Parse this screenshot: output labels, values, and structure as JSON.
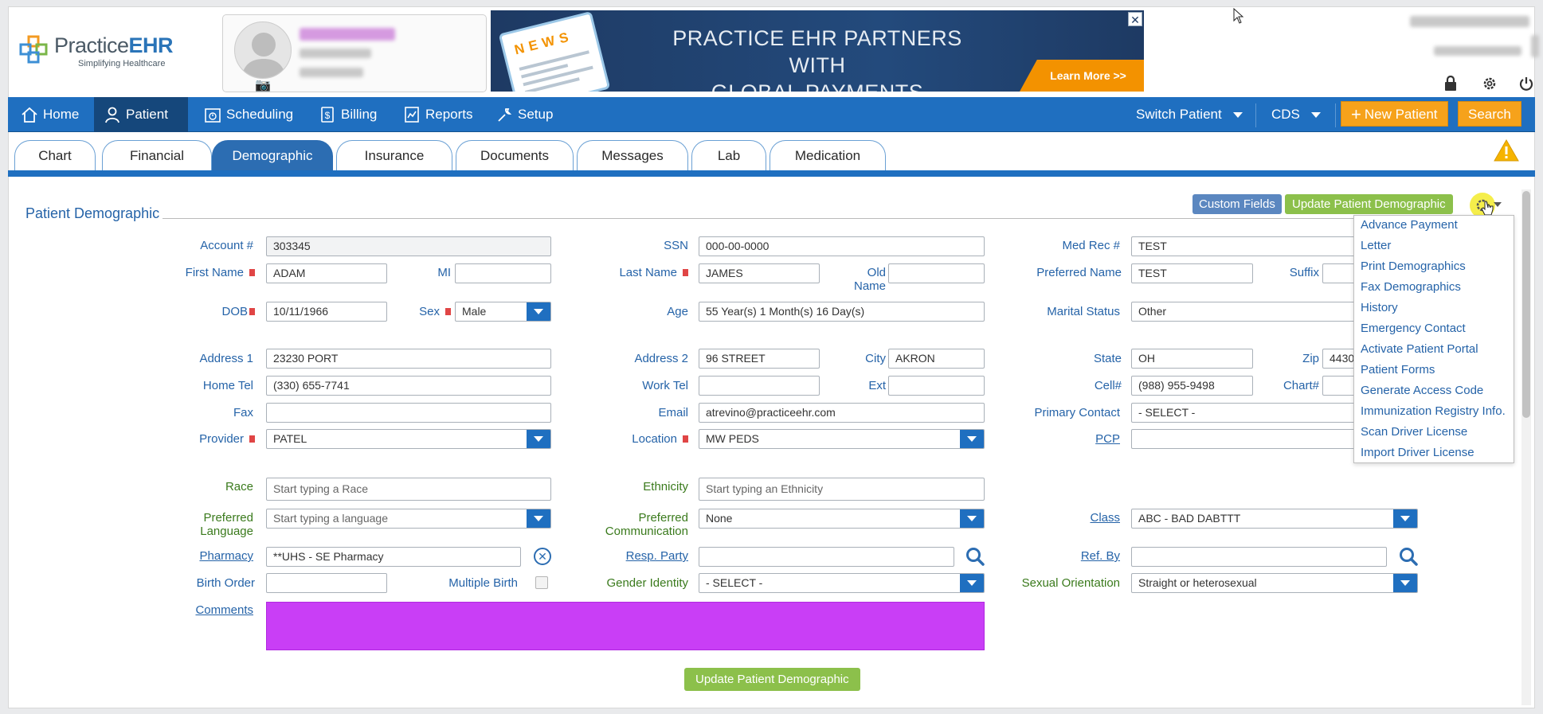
{
  "logo": {
    "name_part1": "Practice",
    "name_part2": "EHR",
    "tagline": "Simplifying Healthcare"
  },
  "banner": {
    "news_label": "NEWS",
    "headline_line1": "PRACTICE EHR PARTNERS WITH",
    "headline_line2": "GLOBAL PAYMENTS INTEGRATED",
    "learn_more": "Learn More >>",
    "close": "✕"
  },
  "nav": {
    "items": [
      "Home",
      "Patient",
      "Scheduling",
      "Billing",
      "Reports",
      "Setup"
    ],
    "active": "Patient",
    "switch_patient": "Switch Patient",
    "cds": "CDS",
    "new_patient": "New Patient",
    "search": "Search"
  },
  "tabs": [
    "Chart",
    "Financial",
    "Demographic",
    "Insurance",
    "Documents",
    "Messages",
    "Lab",
    "Medication"
  ],
  "active_tab": "Demographic",
  "section": {
    "title": "Patient Demographic",
    "custom_fields": "Custom Fields",
    "update": "Update Patient Demographic"
  },
  "labels": {
    "account": "Account #",
    "ssn": "SSN",
    "med_rec": "Med Rec #",
    "first_name": "First Name",
    "mi": "MI",
    "last_name": "Last Name",
    "old_name_1": "Old",
    "old_name_2": "Name",
    "preferred_name": "Preferred Name",
    "suffix": "Suffix",
    "dob": "DOB",
    "sex": "Sex",
    "age": "Age",
    "marital_status": "Marital Status",
    "address1": "Address 1",
    "address2": "Address 2",
    "city": "City",
    "state": "State",
    "zip": "Zip",
    "home_tel": "Home Tel",
    "work_tel": "Work Tel",
    "ext": "Ext",
    "cell": "Cell#",
    "chart": "Chart#",
    "fax": "Fax",
    "email": "Email",
    "primary_contact": "Primary Contact",
    "provider": "Provider",
    "location": "Location",
    "pcp": "PCP",
    "race": "Race",
    "ethnicity": "Ethnicity",
    "pref_lang_1": "Preferred",
    "pref_lang_2": "Language",
    "pref_comm_1": "Preferred",
    "pref_comm_2": "Communication",
    "class": "Class",
    "pharmacy": "Pharmacy",
    "resp_party": "Resp. Party",
    "ref_by": "Ref. By",
    "birth_order": "Birth Order",
    "multiple_birth": "Multiple Birth",
    "gender_identity": "Gender Identity",
    "sexual_orientation": "Sexual Orientation",
    "comments": "Comments"
  },
  "values": {
    "account": "303345",
    "ssn": "000-00-0000",
    "med_rec": "TEST",
    "first_name": "ADAM",
    "mi": "",
    "last_name": "JAMES",
    "old_name": "",
    "preferred_name": "TEST",
    "suffix": "",
    "dob": "10/11/1966",
    "sex": "Male",
    "age": "55 Year(s) 1 Month(s) 16 Day(s)",
    "marital_status": "Other",
    "address1": "23230 PORT",
    "address2": "96 STREET",
    "city": "AKRON",
    "state": "OH",
    "zip": "4430",
    "home_tel": "(330) 655-7741",
    "work_tel": "",
    "ext": "",
    "cell": "(988) 955-9498",
    "chart": "",
    "fax": "",
    "email": "atrevino@practiceehr.com",
    "primary_contact": "- SELECT -",
    "provider": "PATEL",
    "location": "MW PEDS",
    "pcp": "",
    "pref_lang": "",
    "pref_comm": "None",
    "class": "ABC - BAD DABTTT",
    "pharmacy": "**UHS - SE Pharmacy",
    "resp_party": "",
    "ref_by": "",
    "birth_order": "",
    "gender_identity": "- SELECT -",
    "sexual_orientation": "Straight or heterosexual"
  },
  "placeholders": {
    "race": "Start typing a Race",
    "ethnicity": "Start typing an Ethnicity",
    "pref_lang": "Start typing a language"
  },
  "menu": [
    "Advance Payment",
    "Letter",
    "Print Demographics",
    "Fax Demographics",
    "History",
    "Emergency Contact",
    "Activate Patient Portal",
    "Patient Forms",
    "Generate Access Code",
    "Immunization Registry Info.",
    "Scan Driver License",
    "Import Driver License"
  ],
  "bottom_button": "Update Patient Demographic",
  "colors": {
    "nav_blue": "#1f6fc0",
    "accent_orange": "#f6a21b",
    "green": "#8cc04b",
    "comments_bg": "#c93ef6"
  }
}
